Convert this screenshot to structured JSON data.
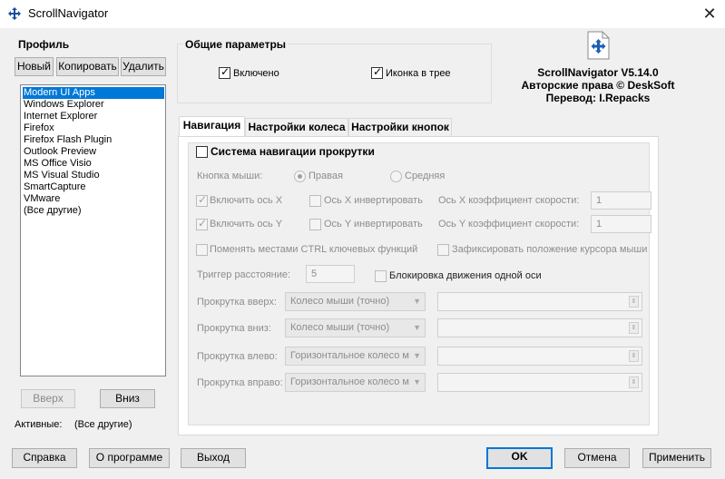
{
  "window": {
    "title": "ScrollNavigator",
    "close_glyph": "✕",
    "icon": "app-move-icon"
  },
  "profile": {
    "title": "Профиль",
    "new_label": "Новый",
    "copy_label": "Копировать",
    "delete_label": "Удалить",
    "items": [
      "Modern UI Apps",
      "Windows Explorer",
      "Internet Explorer",
      "Firefox",
      "Firefox Flash Plugin",
      "Outlook Preview",
      "MS Office Visio",
      "MS Visual Studio",
      "SmartCapture",
      "VMware",
      "(Все другие)"
    ],
    "selected_index": 0,
    "up_label": "Вверх",
    "down_label": "Вниз",
    "active_label": "Активные:",
    "active_value": "(Все другие)"
  },
  "general": {
    "title": "Общие параметры",
    "enabled_label": "Включено",
    "enabled_checked": true,
    "tray_label": "Иконка в трее",
    "tray_checked": true
  },
  "about": {
    "line1": "ScrollNavigator V5.14.0",
    "line2": "Авторские права © DeskSoft",
    "line3": "Перевод: I.Repacks"
  },
  "tabs": [
    "Навигация",
    "Настройки колеса",
    "Настройки кнопок"
  ],
  "active_tab": 0,
  "nav": {
    "system_label": "Система навигации прокрутки",
    "mouse_button_label": "Кнопка мыши:",
    "right_label": "Правая",
    "middle_label": "Средняя",
    "enable_x_label": "Включить ось X",
    "invert_x_label": "Ось X инвертировать",
    "speed_x_label": "Ось X коэффициент скорости:",
    "speed_x_value": "1",
    "enable_y_label": "Включить ось Y",
    "invert_y_label": "Ось Y инвертировать",
    "speed_y_label": "Ось Y коэффициент скорости:",
    "speed_y_value": "1",
    "swap_ctrl_label": "Поменять местами CTRL ключевых функций",
    "fix_cursor_label": "Зафиксировать положение курсора мыши",
    "trigger_label": "Триггер расстояние:",
    "trigger_value": "5",
    "block_axis_label": "Блокировка движения одной оси",
    "scroll_up_label": "Прокрутка вверх:",
    "scroll_up_value": "Колесо мыши (точно)",
    "scroll_down_label": "Прокрутка вниз:",
    "scroll_down_value": "Колесо мыши (точно)",
    "scroll_left_label": "Прокрутка влево:",
    "scroll_left_value": "Горизонтальное колесо м",
    "scroll_right_label": "Прокрутка вправо:",
    "scroll_right_value": "Горизонтальное колесо м"
  },
  "footer": {
    "help_label": "Справка",
    "about_label": "О программе",
    "exit_label": "Выход",
    "ok_label": "OK",
    "cancel_label": "Отмена",
    "apply_label": "Применить"
  }
}
